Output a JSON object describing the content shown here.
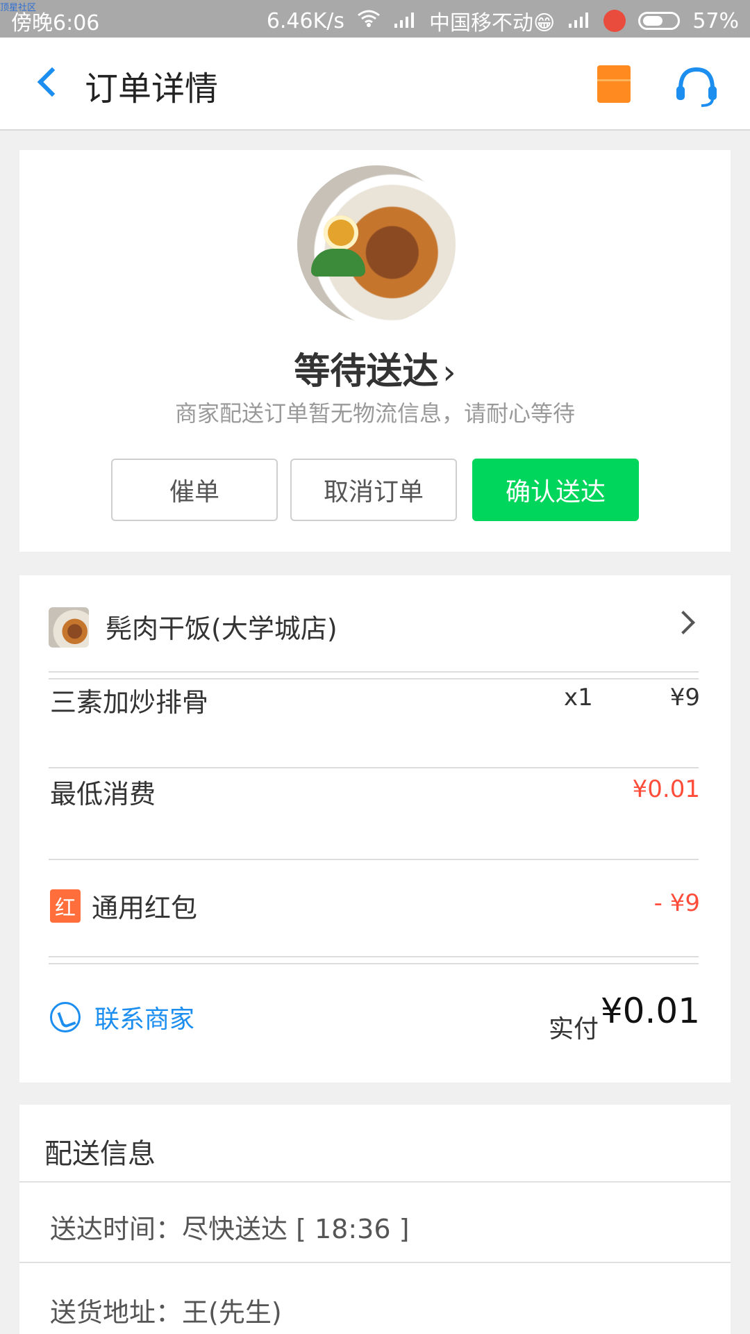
{
  "status_bar": {
    "watermark": "顶星社区",
    "time": "傍晚6:06",
    "network_speed": "6.46K/s",
    "carrier": "中国移不动😁",
    "battery": "57%"
  },
  "header": {
    "title": "订单详情"
  },
  "order_status": {
    "title": "等待送达",
    "chevron": "›",
    "description": "商家配送订单暂无物流信息，请耐心等待",
    "buttons": {
      "remind": "催单",
      "cancel": "取消订单",
      "confirm": "确认送达"
    }
  },
  "order": {
    "shop_name": "髡肉干饭(大学城店)",
    "item": {
      "name": "三素加炒排骨",
      "qty": "x1",
      "price": "¥9"
    },
    "min_fee": {
      "label": "最低消费",
      "value": "¥0.01"
    },
    "hongbao": {
      "badge": "红",
      "label": "通用红包",
      "value": "- ¥9"
    },
    "contact": "联系商家",
    "paid_label": "实付",
    "paid_amount": "¥0.01"
  },
  "delivery": {
    "title": "配送信息",
    "time": "送达时间：尽快送达 [ 18:36 ]",
    "address": "送货地址：王(先生)"
  },
  "colors": {
    "accent_blue": "#1b8ef0",
    "confirm_green": "#00d65c",
    "price_red": "#ff4d3a",
    "coupon_orange": "#ff8a1f"
  }
}
